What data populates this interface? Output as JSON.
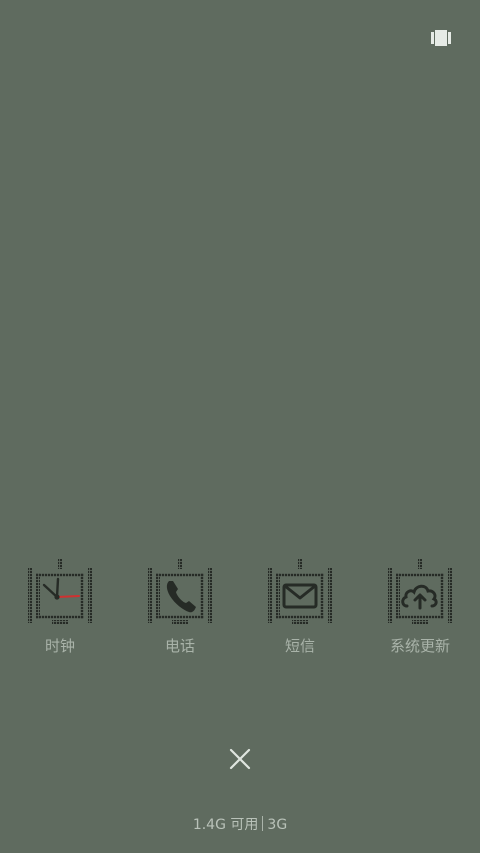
{
  "topbar": {
    "icon": "recent-apps-icon"
  },
  "apps": [
    {
      "label": "时钟",
      "icon": "clock-icon"
    },
    {
      "label": "电话",
      "icon": "phone-icon"
    },
    {
      "label": "短信",
      "icon": "message-icon"
    },
    {
      "label": "系统更新",
      "icon": "cloud-upload-icon"
    }
  ],
  "controls": {
    "close_icon": "close-icon"
  },
  "footer": {
    "memory": "1.4G 可用",
    "network": "3G"
  },
  "colors": {
    "background": "#5f6b5f",
    "label": "#a9b3a9",
    "icon_dark": "#262b26",
    "clock_hand_accent": "#d03030"
  }
}
